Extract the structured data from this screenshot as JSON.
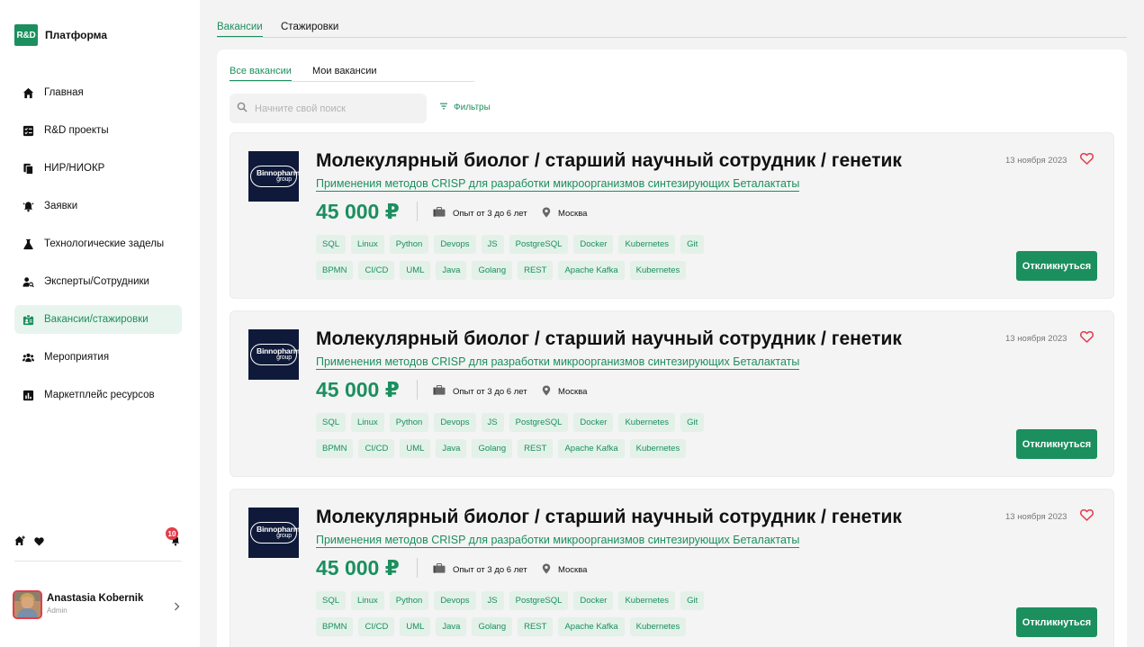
{
  "brand": {
    "logo": "R&D",
    "name": "Платформа"
  },
  "nav": [
    {
      "label": "Главная",
      "icon": "home-icon",
      "active": false
    },
    {
      "label": "R&D проекты",
      "icon": "checklist-icon",
      "active": false
    },
    {
      "label": "НИР/НИОКР",
      "icon": "documents-icon",
      "active": false
    },
    {
      "label": "Заявки",
      "icon": "bell-ringing-icon",
      "active": false
    },
    {
      "label": "Технологические заделы",
      "icon": "flask-icon",
      "active": false
    },
    {
      "label": "Эксперты/Сотрудники",
      "icon": "user-search-icon",
      "active": false
    },
    {
      "label": "Вакансии/стажировки",
      "icon": "id-badge-icon",
      "active": true
    },
    {
      "label": "Мероприятия",
      "icon": "group-icon",
      "active": false
    },
    {
      "label": "Маркетплейс ресурсов",
      "icon": "bar-chart-icon",
      "active": false
    }
  ],
  "notifications_count": "10",
  "user": {
    "name": "Anastasia Kobernik",
    "role": "Admin"
  },
  "top_tabs": [
    {
      "label": "Вакансии",
      "active": true
    },
    {
      "label": "Стажировки",
      "active": false
    }
  ],
  "sub_tabs": [
    {
      "label": "Все вакансии",
      "active": true
    },
    {
      "label": "Мои вакансии",
      "active": false
    }
  ],
  "search": {
    "placeholder": "Начните свой поиск",
    "value": ""
  },
  "filters_label": "Фильтры",
  "vacancies": [
    {
      "company_logo_line1": "Binnopharm",
      "company_logo_line2": "group",
      "title": "Молекулярный биолог / старший научный сотрудник / генетик",
      "subtitle": "Применения методов CRISP для разработки микроорганизмов синтезирующих Беталактаты",
      "salary": "45 000 ₽",
      "experience": "Опыт от 3 до 6 лет",
      "location": "Москва",
      "date": "13 ноября 2023",
      "tags_row1": [
        "SQL",
        "Linux",
        "Python",
        "Devops",
        "JS",
        "PostgreSQL",
        "Docker",
        "Kubernetes",
        "Git"
      ],
      "tags_row2": [
        "BPMN",
        "CI/CD",
        "UML",
        "Java",
        "Golang",
        "REST",
        "Apache Kafka",
        "Kubernetes"
      ],
      "apply_label": "Откликнуться"
    },
    {
      "company_logo_line1": "Binnopharm",
      "company_logo_line2": "group",
      "title": "Молекулярный биолог / старший научный сотрудник / генетик",
      "subtitle": "Применения методов CRISP для разработки микроорганизмов синтезирующих Беталактаты",
      "salary": "45 000 ₽",
      "experience": "Опыт от 3 до 6 лет",
      "location": "Москва",
      "date": "13 ноября 2023",
      "tags_row1": [
        "SQL",
        "Linux",
        "Python",
        "Devops",
        "JS",
        "PostgreSQL",
        "Docker",
        "Kubernetes",
        "Git"
      ],
      "tags_row2": [
        "BPMN",
        "CI/CD",
        "UML",
        "Java",
        "Golang",
        "REST",
        "Apache Kafka",
        "Kubernetes"
      ],
      "apply_label": "Откликнуться"
    },
    {
      "company_logo_line1": "Binnopharm",
      "company_logo_line2": "group",
      "title": "Молекулярный биолог / старший научный сотрудник / генетик",
      "subtitle": "Применения методов CRISP для разработки микроорганизмов синтезирующих Беталактаты",
      "salary": "45 000 ₽",
      "experience": "Опыт от 3 до 6 лет",
      "location": "Москва",
      "date": "13 ноября 2023",
      "tags_row1": [
        "SQL",
        "Linux",
        "Python",
        "Devops",
        "JS",
        "PostgreSQL",
        "Docker",
        "Kubernetes",
        "Git"
      ],
      "tags_row2": [
        "BPMN",
        "CI/CD",
        "UML",
        "Java",
        "Golang",
        "REST",
        "Apache Kafka",
        "Kubernetes"
      ],
      "apply_label": "Откликнуться"
    }
  ],
  "colors": {
    "accent": "#1b8f5e",
    "accent_light": "#e3f1e9",
    "badge": "#e43d4b",
    "logo_bg": "#0f1a3a"
  }
}
